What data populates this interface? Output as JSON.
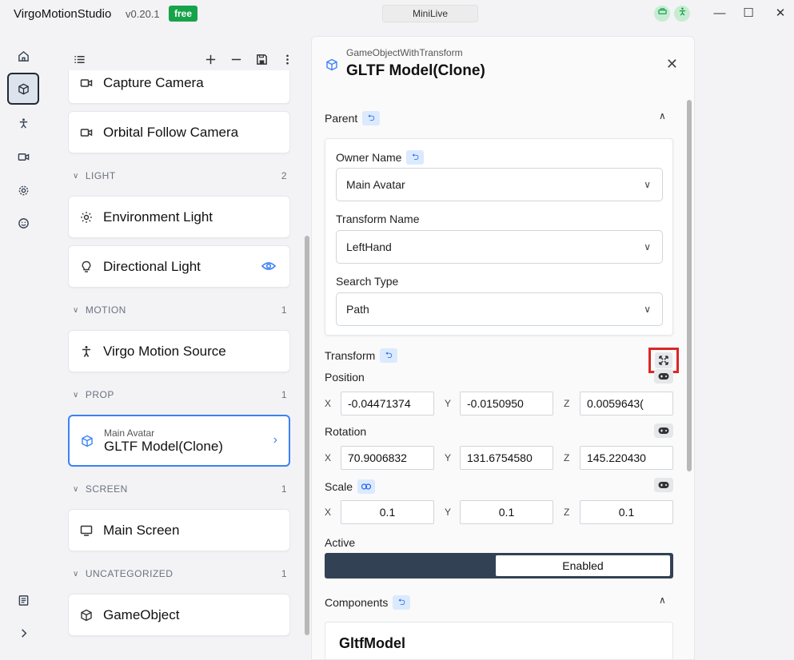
{
  "app": {
    "title": "VirgoMotionStudio",
    "version": "v0.20.1",
    "plan": "free",
    "center_button": "MiniLive"
  },
  "window": {
    "minimize": "—",
    "maximize": "☐",
    "close": "✕"
  },
  "list": {
    "cards": [
      {
        "label": "Capture Camera",
        "icon": "video-camera-icon"
      },
      {
        "label": "Orbital Follow Camera",
        "icon": "video-camera-icon"
      },
      {
        "label": "Environment Light",
        "icon": "sun-icon"
      },
      {
        "label": "Directional Light",
        "icon": "lightbulb-icon"
      },
      {
        "label": "Virgo Motion Source",
        "icon": "person-icon"
      },
      {
        "label": "GLTF Model(Clone)",
        "sub": "Main Avatar",
        "icon": "cube-icon"
      },
      {
        "label": "Main Screen",
        "icon": "monitor-icon"
      },
      {
        "label": "GameObject",
        "icon": "cube-icon"
      }
    ],
    "sections": [
      {
        "label": "LIGHT",
        "count": "2"
      },
      {
        "label": "MOTION",
        "count": "1"
      },
      {
        "label": "PROP",
        "count": "1"
      },
      {
        "label": "SCREEN",
        "count": "1"
      },
      {
        "label": "UNCATEGORIZED",
        "count": "1"
      }
    ]
  },
  "panel": {
    "type": "GameObjectWithTransform",
    "title": "GLTF Model(Clone)",
    "parent_heading": "Parent",
    "owner_name_label": "Owner Name",
    "owner_name_value": "Main Avatar",
    "transform_name_label": "Transform Name",
    "transform_name_value": "LeftHand",
    "search_type_label": "Search Type",
    "search_type_value": "Path",
    "transform_heading": "Transform",
    "position_label": "Position",
    "rotation_label": "Rotation",
    "scale_label": "Scale",
    "axes": [
      "X",
      "Y",
      "Z"
    ],
    "position": [
      "-0.04471374",
      "-0.0150950",
      "0.0059643("
    ],
    "rotation": [
      "70.9006832",
      "131.6754580",
      "145.220430"
    ],
    "scale": [
      "0.1",
      "0.1",
      "0.1"
    ],
    "active_label": "Active",
    "active_value": "Enabled",
    "components_heading": "Components",
    "component_name": "GltfModel"
  }
}
